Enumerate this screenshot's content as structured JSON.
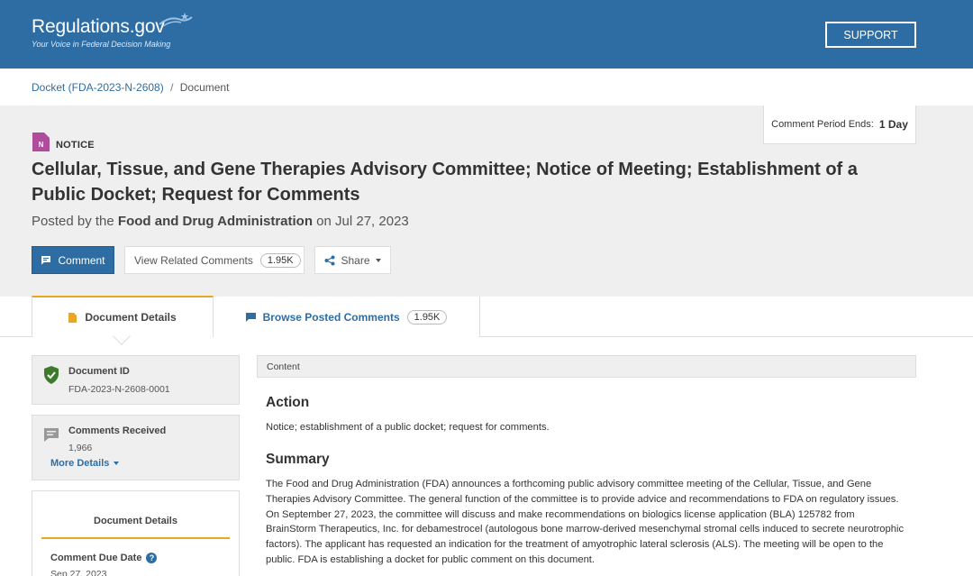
{
  "header": {
    "logo_text": "Regulations.gov",
    "tagline": "Your Voice in Federal Decision Making",
    "support_label": "SUPPORT",
    "brand_color": "#2e6da4"
  },
  "breadcrumb": {
    "docket": "Docket (FDA-2023-N-2608)",
    "separator": "/",
    "current": "Document"
  },
  "doc": {
    "period_label": "Comment Period Ends:",
    "period_value": "1 Day",
    "type_badge": "N",
    "type_label": "NOTICE",
    "title": "Cellular, Tissue, and Gene Therapies Advisory Committee; Notice of Meeting; Establishment of a Public Docket; Request for Comments",
    "posted_prefix": "Posted by the",
    "agency": "Food and Drug Administration",
    "posted_on": "on",
    "date": "Jul 27, 2023"
  },
  "actions": {
    "comment_label": "Comment",
    "related_label": "View Related Comments",
    "related_count": "1.95K",
    "share_label": "Share"
  },
  "tabs": {
    "details_label": "Document Details",
    "browse_label": "Browse Posted Comments",
    "browse_count": "1.95K"
  },
  "sidebar": {
    "doc_id_label": "Document ID",
    "doc_id_value": "FDA-2023-N-2608-0001",
    "comments_label": "Comments Received",
    "comments_value": "1,966",
    "more_details": "More Details",
    "details_title": "Document Details",
    "due_label": "Comment Due Date",
    "due_value": "Sep 27, 2023"
  },
  "content": {
    "bar_label": "Content",
    "action_heading": "Action",
    "action_text": "Notice; establishment of a public docket; request for comments.",
    "summary_heading": "Summary",
    "summary_text": "The Food and Drug Administration (FDA) announces a forthcoming public advisory committee meeting of the Cellular, Tissue, and Gene Therapies Advisory Committee. The general function of the committee is to provide advice and recommendations to FDA on regulatory issues. On September 27, 2023, the committee will discuss and make recommendations on biologics license application (BLA) 125782 from BrainStorm Therapeutics, Inc. for debamestrocel (autologous bone marrow-derived mesenchymal stromal cells induced to secrete neurotrophic factors). The applicant has requested an indication for the treatment of amyotrophic lateral sclerosis (ALS). The meeting will be open to the public. FDA is establishing a docket for public comment on this document."
  }
}
